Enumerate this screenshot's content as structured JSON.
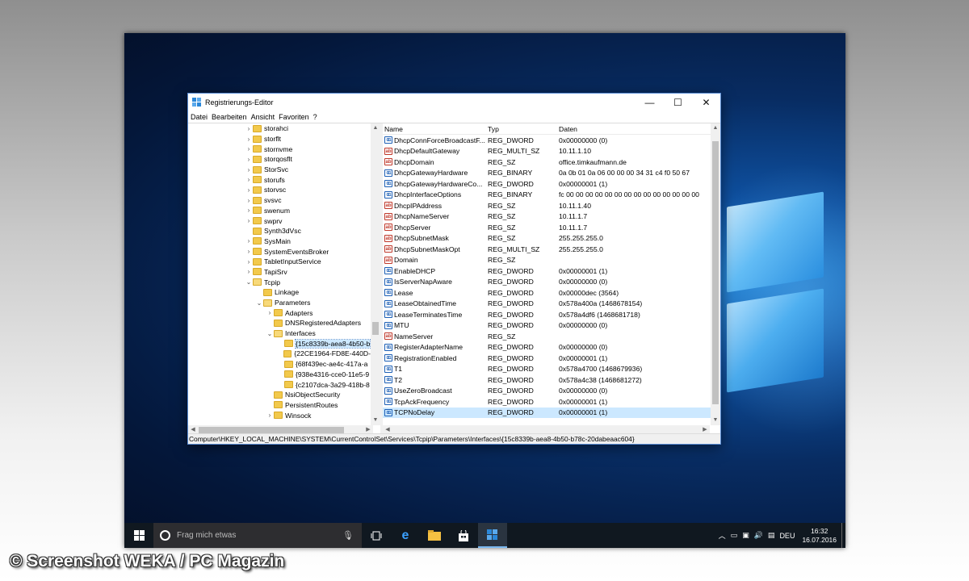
{
  "window": {
    "title": "Registrierungs-Editor",
    "controls": {
      "minimize": "—",
      "maximize": "☐",
      "close": "✕"
    }
  },
  "menu": [
    "Datei",
    "Bearbeiten",
    "Ansicht",
    "Favoriten",
    "?"
  ],
  "tree": [
    {
      "label": "storahci",
      "depth": 0,
      "expander": ">"
    },
    {
      "label": "storflt",
      "depth": 0,
      "expander": ">"
    },
    {
      "label": "stornvme",
      "depth": 0,
      "expander": ">"
    },
    {
      "label": "storqosflt",
      "depth": 0,
      "expander": ">"
    },
    {
      "label": "StorSvc",
      "depth": 0,
      "expander": ">"
    },
    {
      "label": "storufs",
      "depth": 0,
      "expander": ">"
    },
    {
      "label": "storvsc",
      "depth": 0,
      "expander": ">"
    },
    {
      "label": "svsvc",
      "depth": 0,
      "expander": ">"
    },
    {
      "label": "swenum",
      "depth": 0,
      "expander": ">"
    },
    {
      "label": "swprv",
      "depth": 0,
      "expander": ">"
    },
    {
      "label": "Synth3dVsc",
      "depth": 0,
      "expander": ""
    },
    {
      "label": "SysMain",
      "depth": 0,
      "expander": ">"
    },
    {
      "label": "SystemEventsBroker",
      "depth": 0,
      "expander": ">"
    },
    {
      "label": "TabletInputService",
      "depth": 0,
      "expander": ">"
    },
    {
      "label": "TapiSrv",
      "depth": 0,
      "expander": ">"
    },
    {
      "label": "Tcpip",
      "depth": 0,
      "expander": "v",
      "open": true
    },
    {
      "label": "Linkage",
      "depth": 1,
      "expander": ""
    },
    {
      "label": "Parameters",
      "depth": 1,
      "expander": "v",
      "open": true
    },
    {
      "label": "Adapters",
      "depth": 2,
      "expander": ">"
    },
    {
      "label": "DNSRegisteredAdapters",
      "depth": 2,
      "expander": ""
    },
    {
      "label": "Interfaces",
      "depth": 2,
      "expander": "v",
      "open": true
    },
    {
      "label": "{15c8339b-aea8-4b50-b",
      "depth": 3,
      "expander": "",
      "selected": true
    },
    {
      "label": "{22CE1964-FD8E-440D-",
      "depth": 3,
      "expander": ""
    },
    {
      "label": "{68f439ec-ae4c-417a-a",
      "depth": 3,
      "expander": ""
    },
    {
      "label": "{938e4316-cce0-11e5-9",
      "depth": 3,
      "expander": ""
    },
    {
      "label": "{c2107dca-3a29-418b-8",
      "depth": 3,
      "expander": ""
    },
    {
      "label": "NsiObjectSecurity",
      "depth": 2,
      "expander": ""
    },
    {
      "label": "PersistentRoutes",
      "depth": 2,
      "expander": ""
    },
    {
      "label": "Winsock",
      "depth": 2,
      "expander": ">"
    }
  ],
  "list": {
    "columns": [
      "Name",
      "Typ",
      "Daten"
    ],
    "rows": [
      {
        "name": "DhcpConnForceBroadcastF...",
        "type": "REG_DWORD",
        "data": "0x00000000 (0)",
        "kind": "bin"
      },
      {
        "name": "DhcpDefaultGateway",
        "type": "REG_MULTI_SZ",
        "data": "10.11.1.10",
        "kind": "str"
      },
      {
        "name": "DhcpDomain",
        "type": "REG_SZ",
        "data": "office.timkaufmann.de",
        "kind": "str"
      },
      {
        "name": "DhcpGatewayHardware",
        "type": "REG_BINARY",
        "data": "0a 0b 01 0a 06 00 00 00 34 31 c4 f0 50 67",
        "kind": "bin"
      },
      {
        "name": "DhcpGatewayHardwareCo...",
        "type": "REG_DWORD",
        "data": "0x00000001 (1)",
        "kind": "bin"
      },
      {
        "name": "DhcpInterfaceOptions",
        "type": "REG_BINARY",
        "data": "fc 00 00 00 00 00 00 00 00 00 00 00 00 00 00",
        "kind": "bin"
      },
      {
        "name": "DhcpIPAddress",
        "type": "REG_SZ",
        "data": "10.11.1.40",
        "kind": "str"
      },
      {
        "name": "DhcpNameServer",
        "type": "REG_SZ",
        "data": "10.11.1.7",
        "kind": "str"
      },
      {
        "name": "DhcpServer",
        "type": "REG_SZ",
        "data": "10.11.1.7",
        "kind": "str"
      },
      {
        "name": "DhcpSubnetMask",
        "type": "REG_SZ",
        "data": "255.255.255.0",
        "kind": "str"
      },
      {
        "name": "DhcpSubnetMaskOpt",
        "type": "REG_MULTI_SZ",
        "data": "255.255.255.0",
        "kind": "str"
      },
      {
        "name": "Domain",
        "type": "REG_SZ",
        "data": "",
        "kind": "str"
      },
      {
        "name": "EnableDHCP",
        "type": "REG_DWORD",
        "data": "0x00000001 (1)",
        "kind": "bin"
      },
      {
        "name": "IsServerNapAware",
        "type": "REG_DWORD",
        "data": "0x00000000 (0)",
        "kind": "bin"
      },
      {
        "name": "Lease",
        "type": "REG_DWORD",
        "data": "0x00000dec (3564)",
        "kind": "bin"
      },
      {
        "name": "LeaseObtainedTime",
        "type": "REG_DWORD",
        "data": "0x578a400a (1468678154)",
        "kind": "bin"
      },
      {
        "name": "LeaseTerminatesTime",
        "type": "REG_DWORD",
        "data": "0x578a4df6 (1468681718)",
        "kind": "bin"
      },
      {
        "name": "MTU",
        "type": "REG_DWORD",
        "data": "0x00000000 (0)",
        "kind": "bin"
      },
      {
        "name": "NameServer",
        "type": "REG_SZ",
        "data": "",
        "kind": "str"
      },
      {
        "name": "RegisterAdapterName",
        "type": "REG_DWORD",
        "data": "0x00000000 (0)",
        "kind": "bin"
      },
      {
        "name": "RegistrationEnabled",
        "type": "REG_DWORD",
        "data": "0x00000001 (1)",
        "kind": "bin"
      },
      {
        "name": "T1",
        "type": "REG_DWORD",
        "data": "0x578a4700 (1468679936)",
        "kind": "bin"
      },
      {
        "name": "T2",
        "type": "REG_DWORD",
        "data": "0x578a4c38 (1468681272)",
        "kind": "bin"
      },
      {
        "name": "UseZeroBroadcast",
        "type": "REG_DWORD",
        "data": "0x00000000 (0)",
        "kind": "bin"
      },
      {
        "name": "TcpAckFrequency",
        "type": "REG_DWORD",
        "data": "0x00000001 (1)",
        "kind": "bin"
      },
      {
        "name": "TCPNoDelay",
        "type": "REG_DWORD",
        "data": "0x00000001 (1)",
        "kind": "bin",
        "selected": true
      }
    ]
  },
  "statusbar": "Computer\\HKEY_LOCAL_MACHINE\\SYSTEM\\CurrentControlSet\\Services\\Tcpip\\Parameters\\Interfaces\\{15c8339b-aea8-4b50-b78c-20dabeaac604}",
  "taskbar": {
    "search_placeholder": "Frag mich etwas",
    "language": "DEU",
    "time": "16:32",
    "date": "16.07.2016"
  },
  "watermark": "© Screenshot WEKA / PC Magazin",
  "icons": {
    "string_value": "ab",
    "binary_value": "011\n110"
  },
  "colors": {
    "accent": "#0078d7",
    "selection": "#cce8ff",
    "taskbar": "#101820"
  }
}
